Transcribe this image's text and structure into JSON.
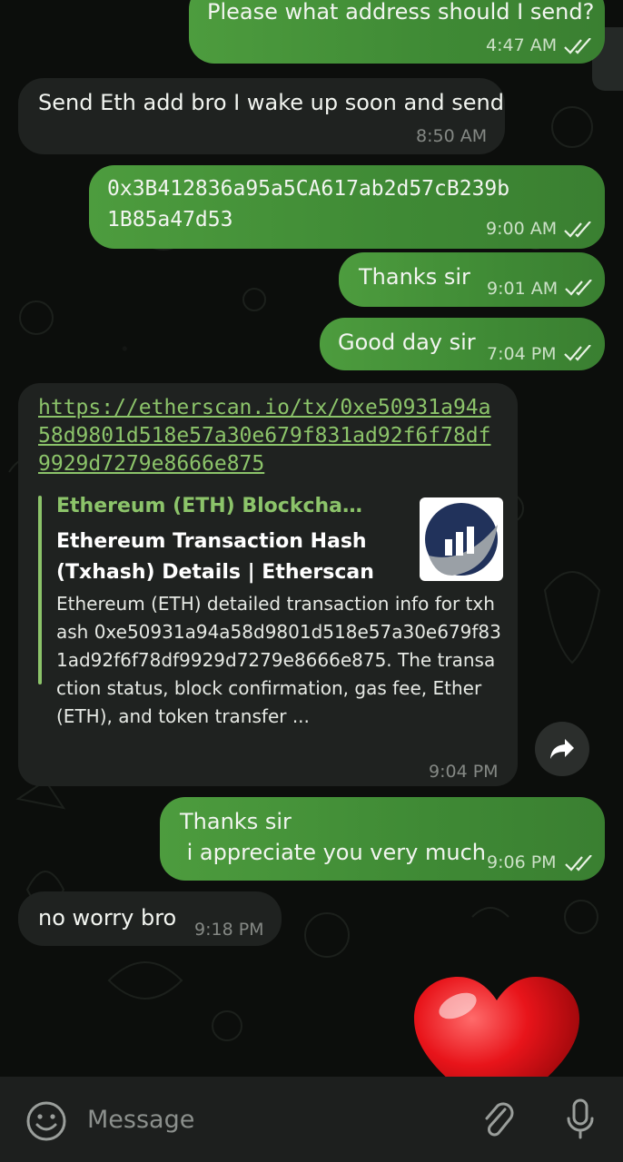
{
  "messages": [
    {
      "direction": "outgoing",
      "text": "Please what address should I send?",
      "time": "4:47 AM",
      "status": "read"
    },
    {
      "direction": "incoming",
      "text": "Send Eth add bro I wake up soon and send",
      "time": "8:50 AM"
    },
    {
      "direction": "outgoing",
      "text_line1": "0x3B412836a95a5CA617ab2d57cB239b",
      "text_line2": "1B85a47d53",
      "time": "9:00 AM",
      "status": "read"
    },
    {
      "direction": "outgoing",
      "text": "Thanks sir",
      "time": "9:01 AM",
      "status": "read"
    },
    {
      "direction": "outgoing",
      "text": "Good day sir",
      "time": "7:04 PM",
      "status": "read"
    },
    {
      "direction": "incoming",
      "link": "https://etherscan.io/tx/0xe50931a94a58d9801d518e57a30e679f831ad92f6f78df9929d7279e8666e875",
      "preview": {
        "site": "Ethereum (ETH) Blockchai...",
        "title": "Ethereum Transaction Hash (Txhash) Details | Etherscan",
        "description": "Ethereum (ETH) detailed transaction info for txhash 0xe50931a94a58d9801d518e57a30e679f831ad92f6f78df9929d7279e8666e875. The transaction status, block confirmation, gas fee, Ether (ETH), and token transfer ..."
      },
      "time": "9:04 PM"
    },
    {
      "direction": "outgoing",
      "text_line1": "Thanks sir",
      "text_line2": " i appreciate you very much",
      "time": "9:06 PM",
      "status": "read"
    },
    {
      "direction": "incoming",
      "text": "no worry bro",
      "time": "9:18 PM"
    }
  ],
  "sticker": "red-heart",
  "composer": {
    "placeholder": "Message"
  },
  "icons": {
    "emoji": "smiley-face-icon",
    "attach": "paperclip-icon",
    "mic": "microphone-icon",
    "share": "share-arrow-icon",
    "read": "double-check-icon"
  },
  "colors": {
    "outgoing_bubble": "#4a9a3d",
    "incoming_bubble": "#1f2220",
    "link": "#8cc46a",
    "background": "#0c0e0c"
  }
}
